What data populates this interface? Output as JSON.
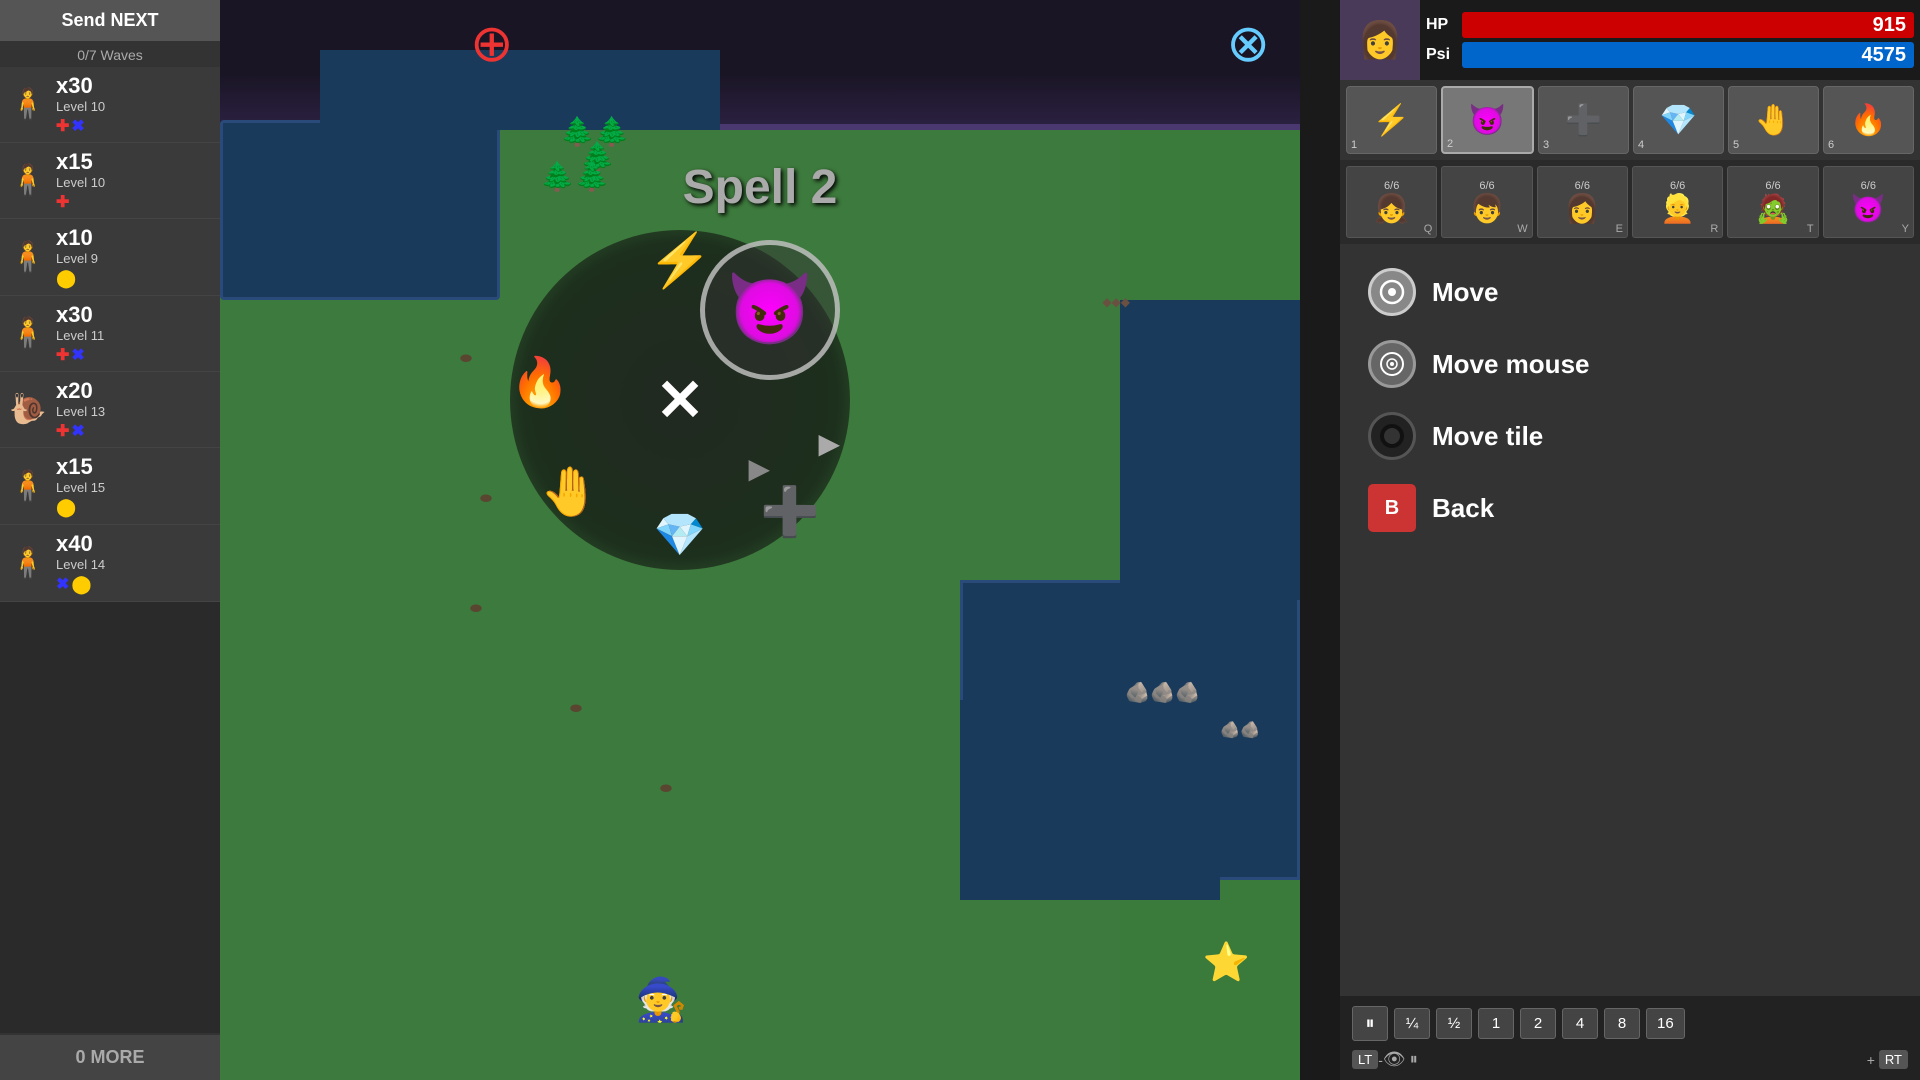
{
  "sidebar": {
    "send_next_label": "Send NEXT",
    "wave_count": "0/7 Waves",
    "units": [
      {
        "count": "x30",
        "level": "Level 10",
        "color": "blue",
        "icons": [
          "red-plus",
          "blue-x"
        ]
      },
      {
        "count": "x15",
        "level": "Level 10",
        "color": "purple",
        "icons": [
          "red-plus"
        ]
      },
      {
        "count": "x10",
        "level": "Level 9",
        "color": "blue",
        "icons": [
          "yellow-dot"
        ]
      },
      {
        "count": "x30",
        "level": "Level 11",
        "color": "purple",
        "icons": [
          "red-plus",
          "blue-x"
        ]
      },
      {
        "count": "x20",
        "level": "Level 13",
        "color": "snail",
        "icons": [
          "red-plus",
          "blue-x"
        ]
      },
      {
        "count": "x15",
        "level": "Level 15",
        "color": "blue",
        "icons": [
          "yellow-dot"
        ]
      },
      {
        "count": "x40",
        "level": "Level 14",
        "color": "purple",
        "icons": [
          "blue-x",
          "yellow-dot"
        ]
      }
    ],
    "zero_more": "0 MORE"
  },
  "player": {
    "hp_label": "HP",
    "hp_value": "915",
    "psi_label": "Psi",
    "psi_value": "4575",
    "avatar": "👩"
  },
  "spells": [
    {
      "icon": "⚡",
      "num": "1"
    },
    {
      "icon": "😈",
      "num": "2"
    },
    {
      "icon": "➕",
      "num": "3"
    },
    {
      "icon": "💎",
      "num": "4"
    },
    {
      "icon": "🤚",
      "num": "5"
    },
    {
      "icon": "🔥",
      "num": "6"
    }
  ],
  "characters": [
    {
      "portrait": "👧",
      "key": "Q",
      "count": "6/6"
    },
    {
      "portrait": "👦",
      "key": "W",
      "count": "6/6"
    },
    {
      "portrait": "👩",
      "key": "E",
      "count": "6/6"
    },
    {
      "portrait": "👱",
      "key": "R",
      "count": "6/6"
    },
    {
      "portrait": "🧟",
      "key": "T",
      "count": "6/6"
    },
    {
      "portrait": "😈",
      "key": "Y",
      "count": "6/6"
    }
  ],
  "context_menu": {
    "items": [
      {
        "type": "move",
        "label": "Move",
        "icon": "⊕"
      },
      {
        "type": "mouse",
        "label": "Move mouse",
        "icon": "⊙"
      },
      {
        "type": "tile",
        "label": "Move tile",
        "icon": "●"
      },
      {
        "type": "back",
        "label": "Back",
        "icon": "B"
      }
    ]
  },
  "speed_controls": {
    "pause": "⏸",
    "speeds": [
      "¼",
      "½",
      "1",
      "2",
      "4",
      "8",
      "16"
    ]
  },
  "map": {
    "spell_label": "Spell 2",
    "add_btn": "⊕",
    "remove_btn": "⊗"
  },
  "radial": {
    "lightning": "⚡",
    "fire": "🔥",
    "hand": "🤚",
    "crystal": "💎",
    "cross_label": "✕"
  }
}
